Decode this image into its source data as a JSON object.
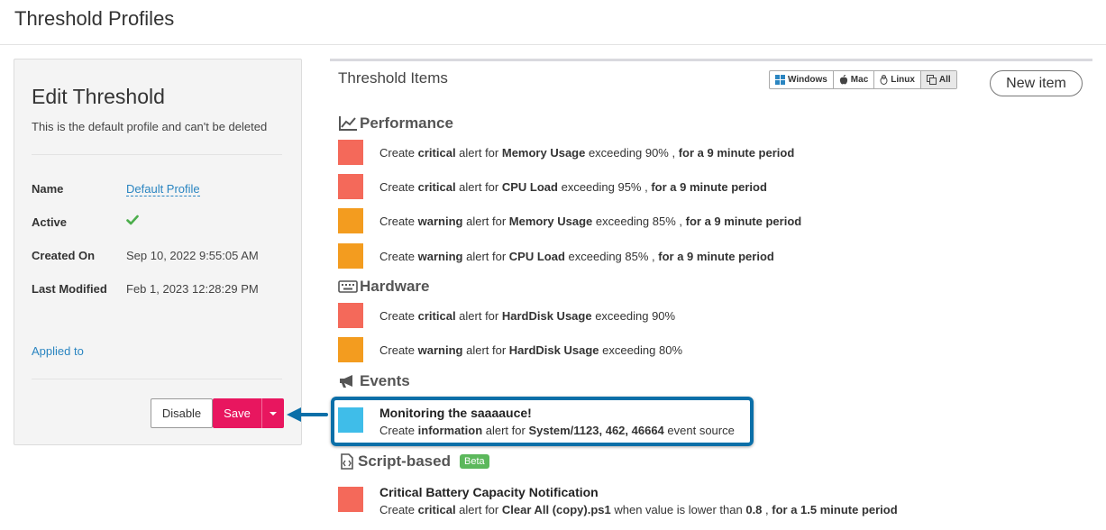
{
  "page": {
    "title": "Threshold Profiles"
  },
  "edit_panel": {
    "title": "Edit Threshold",
    "description": "This is the default profile and can't be deleted",
    "fields": {
      "name_label": "Name",
      "name_value": "Default Profile",
      "active_label": "Active",
      "active_icon": "check-icon",
      "created_label": "Created On",
      "created_value": "Sep 10, 2022 9:55:05 AM",
      "modified_label": "Last Modified",
      "modified_value": "Feb 1, 2023 12:28:29 PM"
    },
    "applied_to": "Applied to",
    "buttons": {
      "disable": "Disable",
      "save": "Save"
    },
    "colors": {
      "save": "#e8165f",
      "link": "#2a85c1",
      "check": "#4cae4c"
    }
  },
  "items_panel": {
    "title": "Threshold Items",
    "os_filter": [
      {
        "label": "Windows",
        "icon": "windows-icon",
        "active": false
      },
      {
        "label": "Mac",
        "icon": "apple-icon",
        "active": false
      },
      {
        "label": "Linux",
        "icon": "linux-icon",
        "active": false
      },
      {
        "label": "All",
        "icon": "copy-icon",
        "active": true
      }
    ],
    "new_item": "New item",
    "severity_colors": {
      "critical": "#f4695a",
      "warning": "#f39c1f",
      "information": "#3fbde9"
    },
    "sections": {
      "performance": {
        "title": "Performance",
        "icon": "line-chart-icon",
        "items": [
          {
            "severity": "critical",
            "p1": "Create ",
            "sev": "critical",
            "p2": " alert for ",
            "metric": "Memory Usage",
            "p3": " exceeding 90% , ",
            "period": "for a 9 minute period"
          },
          {
            "severity": "critical",
            "p1": "Create ",
            "sev": "critical",
            "p2": " alert for ",
            "metric": "CPU Load",
            "p3": " exceeding 95% , ",
            "period": "for a 9 minute period"
          },
          {
            "severity": "warning",
            "p1": "Create ",
            "sev": "warning",
            "p2": " alert for ",
            "metric": "Memory Usage",
            "p3": " exceeding 85% , ",
            "period": "for a 9 minute period"
          },
          {
            "severity": "warning",
            "p1": "Create ",
            "sev": "warning",
            "p2": " alert for ",
            "metric": "CPU Load",
            "p3": " exceeding 85% , ",
            "period": "for a 9 minute period"
          }
        ]
      },
      "hardware": {
        "title": "Hardware",
        "icon": "keyboard-icon",
        "items": [
          {
            "severity": "critical",
            "p1": "Create ",
            "sev": "critical",
            "p2": " alert for ",
            "metric": "HardDisk Usage",
            "p3": " exceeding 90%"
          },
          {
            "severity": "warning",
            "p1": "Create ",
            "sev": "warning",
            "p2": " alert for ",
            "metric": "HardDisk Usage",
            "p3": " exceeding 80%"
          }
        ]
      },
      "events": {
        "title": "Events",
        "icon": "megaphone-icon",
        "items": [
          {
            "severity": "information",
            "title": "Monitoring the saaaauce!",
            "p1": "Create ",
            "sev": "information",
            "p2": " alert for ",
            "source": "System/1123, 462, 46664",
            "p3": " event source"
          }
        ]
      },
      "script": {
        "title": "Script-based",
        "icon": "file-code-icon",
        "badge": "Beta",
        "items": [
          {
            "severity": "critical",
            "title": "Critical Battery Capacity Notification",
            "p1": "Create ",
            "sev": "critical",
            "p2": " alert for ",
            "script": "Clear All (copy).ps1",
            "p3": " when value is lower than ",
            "value": "0.8",
            "p4": " , ",
            "period": "for a 1.5 minute period"
          }
        ]
      }
    }
  }
}
